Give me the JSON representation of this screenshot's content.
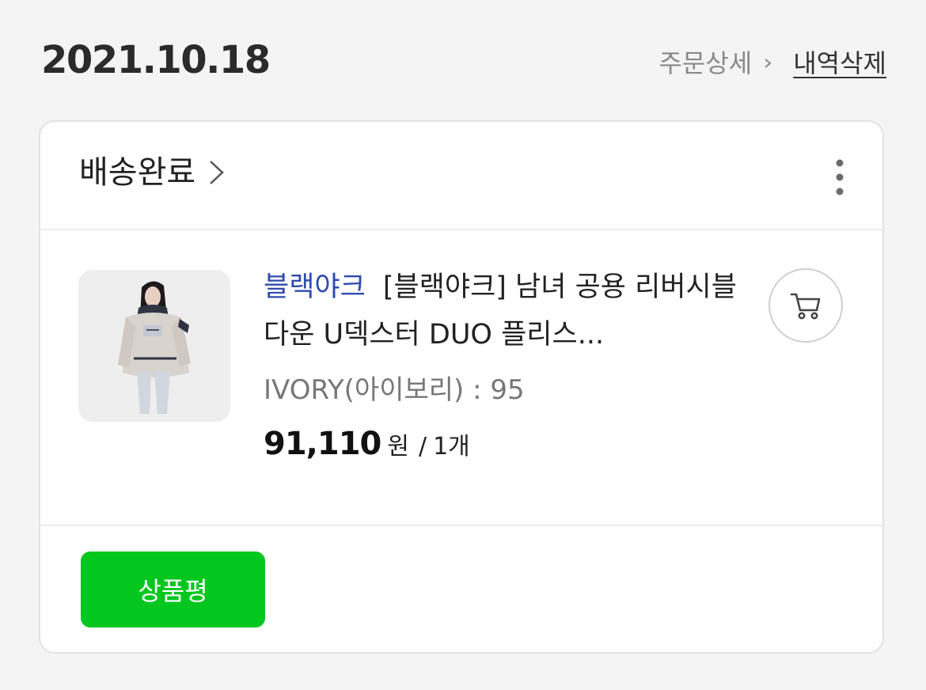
{
  "order": {
    "date": "2021.10.18",
    "detail_link_label": "주문상세",
    "delete_link_label": "내역삭제"
  },
  "card": {
    "status_label": "배송완료",
    "more_icon": "more-vertical-icon"
  },
  "product": {
    "brand": "블랙야크",
    "title": "[블랙야크] 남녀 공용 리버시블 다운 U덱스터 DUO 플리스...",
    "option": "IVORY(아이보리) : 95",
    "price": "91,110",
    "price_unit": "원",
    "price_separator": "/",
    "quantity": "1개",
    "thumbnail_icon": "product-photo",
    "cart_icon": "cart-icon"
  },
  "actions": {
    "review_label": "상품평"
  },
  "colors": {
    "background": "#f4f4f4",
    "brand_text": "#2e4bad",
    "review_button": "#03c71f"
  }
}
